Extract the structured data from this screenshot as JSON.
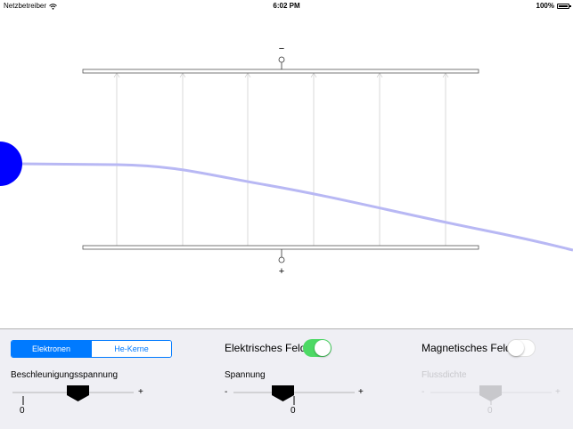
{
  "status_bar": {
    "carrier": "Netzbetreiber",
    "time": "6:02 PM",
    "battery": "100%"
  },
  "plates": {
    "top_sign": "−",
    "bottom_sign": "+"
  },
  "particle_selector": {
    "options": [
      "Elektronen",
      "He-Kerne"
    ],
    "selected": "Elektronen"
  },
  "electric_field": {
    "label": "Elektrisches Feld",
    "enabled": true
  },
  "magnetic_field": {
    "label": "Magnetisches Feld",
    "enabled": false
  },
  "sliders": {
    "acceleration": {
      "title": "Beschleunigungsspannung",
      "value": "0",
      "plus": "+",
      "level": 0.5
    },
    "voltage": {
      "title": "Spannung",
      "value": "0",
      "minus": "-",
      "plus": "+",
      "level": 0.5
    },
    "flux": {
      "title": "Flussdichte",
      "value": "0",
      "minus": "-",
      "plus": "+",
      "level": 0.5,
      "disabled": true
    }
  },
  "colors": {
    "accent": "#007aff",
    "switch_on": "#4cd964",
    "particle": "#0000ff",
    "beam": "#b8b8f4"
  }
}
